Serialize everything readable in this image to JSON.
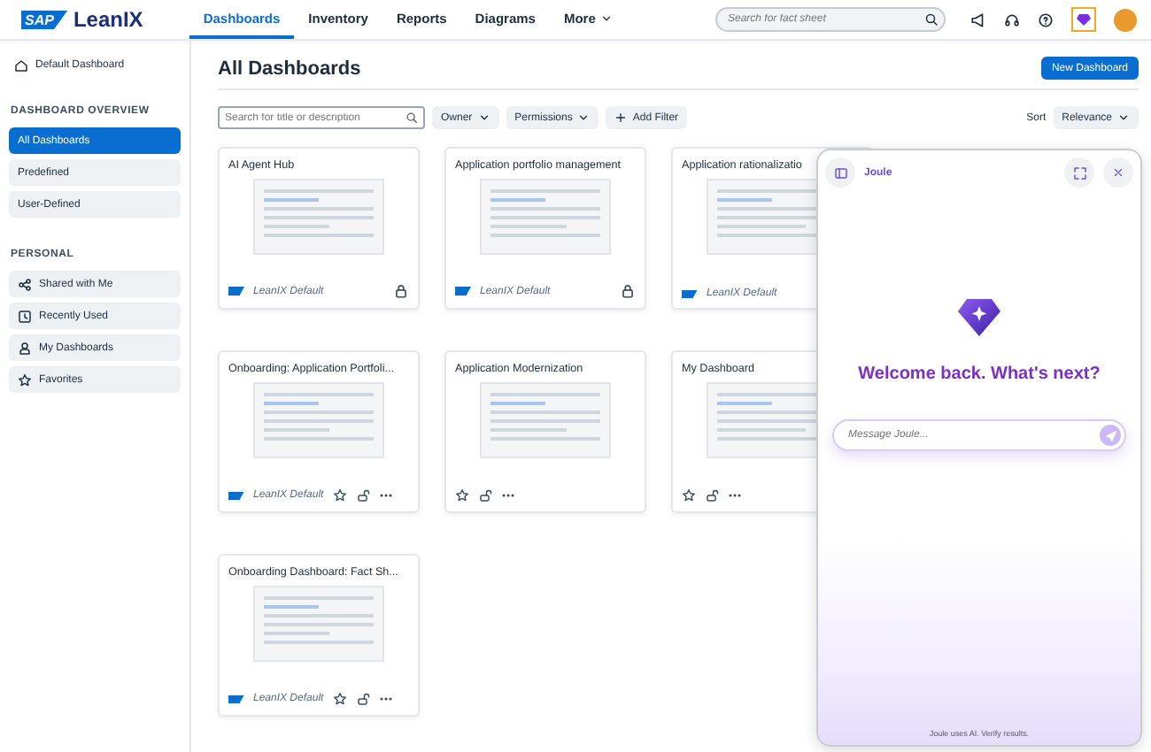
{
  "header": {
    "logo": {
      "brand": "SAP",
      "product": "LeanIX"
    },
    "nav": [
      {
        "label": "Dashboards",
        "selected": true,
        "kind": "link"
      },
      {
        "label": "Inventory",
        "selected": false,
        "kind": "link"
      },
      {
        "label": "Reports",
        "selected": false,
        "kind": "link"
      },
      {
        "label": "Diagrams",
        "selected": false,
        "kind": "link"
      },
      {
        "label": "More",
        "selected": false,
        "kind": "menu"
      }
    ],
    "search": {
      "placeholder": "Search for fact sheet"
    },
    "joule_button": {
      "selected": true
    }
  },
  "sidebar": {
    "home": "Default Dashboard",
    "sections": [
      {
        "title": "DASHBOARD OVERVIEW",
        "items": [
          {
            "label": "All Dashboards",
            "selected": true
          },
          {
            "label": "Predefined",
            "selected": false
          },
          {
            "label": "User-Defined",
            "selected": false
          }
        ]
      },
      {
        "title": "PERSONAL",
        "items": [
          {
            "label": "Shared with Me",
            "selected": false
          },
          {
            "label": "Recently Used",
            "selected": false
          },
          {
            "label": "My Dashboards",
            "selected": false
          },
          {
            "label": "Favorites",
            "selected": false
          }
        ]
      }
    ]
  },
  "main": {
    "title": "All Dashboards",
    "new_button": "New Dashboard",
    "filters": {
      "placeholder": "Search for title or description",
      "dropdowns": [
        "Owner",
        "Permissions"
      ],
      "add_filter": "Add Filter"
    },
    "sort": {
      "label": "Sort",
      "value": "Relevance"
    },
    "cards": [
      {
        "title": "AI Agent Hub",
        "owner": "LeanIX Default",
        "kind": "locked"
      },
      {
        "title": "Application portfolio management",
        "owner": "LeanIX Default",
        "kind": "locked"
      },
      {
        "title": "Application rationalizatio",
        "owner": "LeanIX Default",
        "kind": "covered"
      },
      {
        "title": "Onboarding: Application Portfoli...",
        "owner": "LeanIX Default",
        "kind": "editable"
      },
      {
        "title": "Application Modernization",
        "kind": "editable"
      },
      {
        "title": "My Dashboard",
        "kind": "editable"
      },
      {
        "title": "Onboarding Dashboard: Fact Sh...",
        "owner": "LeanIX Default",
        "kind": "editable"
      }
    ]
  },
  "joule": {
    "title": "Joule",
    "greeting": "Welcome back. What's next?",
    "input": {
      "placeholder": "Message Joule..."
    },
    "disclaimer": "Joule uses AI. Verify results."
  }
}
